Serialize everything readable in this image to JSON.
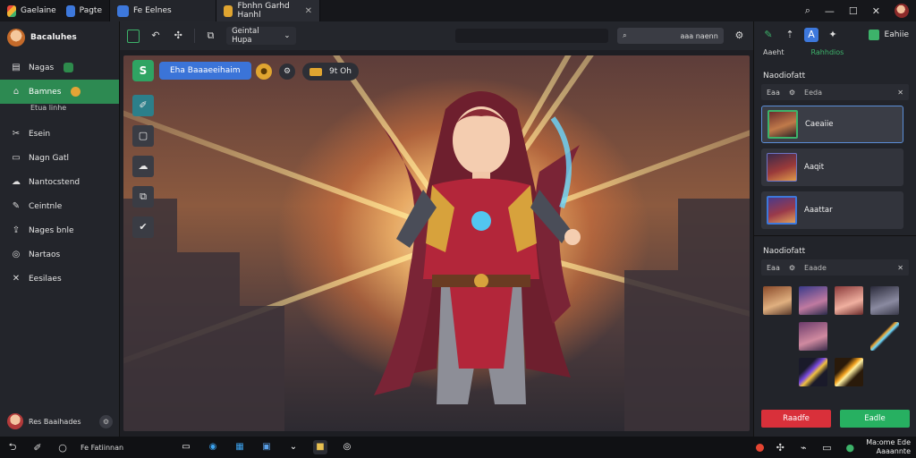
{
  "titlebar": {
    "app_name": "Gaelaine",
    "tab2_label": "Pagte",
    "tab3_label": "Fe Eelnes",
    "tab4_label": "Fbnhn Garhd Hanhl",
    "icons": [
      "search-icon",
      "minimize-icon",
      "maximize-icon",
      "close-icon"
    ],
    "accent_app": "#2e8b4c",
    "accent_tab": "#3d78dc"
  },
  "sidebar": {
    "profile_name": "Bacaluhes",
    "items": [
      {
        "label": "Nagas",
        "icon": "layers-icon",
        "badge": true
      },
      {
        "label": "Bamnes",
        "icon": "home-icon",
        "badge": true,
        "active": true,
        "sub": "Etua linhe"
      },
      {
        "label": "Esein",
        "icon": "tools-icon"
      },
      {
        "label": "Nagn Gatl",
        "icon": "image-icon"
      },
      {
        "label": "Nantocstend",
        "icon": "cloud-icon"
      },
      {
        "label": "Ceintnle",
        "icon": "pen-icon"
      },
      {
        "label": "Nages bnle",
        "icon": "upload-icon"
      },
      {
        "label": "Nartaos",
        "icon": "globe-icon"
      },
      {
        "label": "Eesilaes",
        "icon": "settings-icon"
      }
    ],
    "footer_name": "Res Baaihades",
    "footer_icon": "gear-icon"
  },
  "toolbar": {
    "dropdown_label": "Geintal Hupa",
    "search_label": "aaa naenn",
    "icons": [
      "frame-icon",
      "undo-icon",
      "magic-icon",
      "crop-icon",
      "chevron-down-icon",
      "search-icon",
      "settings-icon"
    ]
  },
  "canvas": {
    "badge_letter": "S",
    "badge_label": "Eha Baaaeeihaim",
    "chip_value": "9t Oh"
  },
  "right_panel": {
    "share_label": "Eahiie",
    "tabs": [
      "Aaeht",
      "Rahhdios"
    ],
    "section1_title": "Naodiofatt",
    "section1_filter": {
      "left": "Eaa",
      "mid": "Eeda",
      "end": "✕"
    },
    "layers": [
      {
        "label": "Caeaiie",
        "selected": true
      },
      {
        "label": "Aaqit",
        "selected": false
      },
      {
        "label": "Aaattar",
        "selected": false
      }
    ],
    "section2_title": "Naodiofatt",
    "section2_filter": {
      "left": "Eaa",
      "mid": "Eaade",
      "end": "✕"
    },
    "cancel_label": "Raadfe",
    "apply_label": "Eadle",
    "colors": {
      "cancel": "#d9303a",
      "apply": "#27b061",
      "selection": "#5b8ed8"
    }
  },
  "taskbar": {
    "left_label": "Fe Fatiinnan",
    "time": "Ma:ome Ede",
    "date": "Aaaannte"
  }
}
